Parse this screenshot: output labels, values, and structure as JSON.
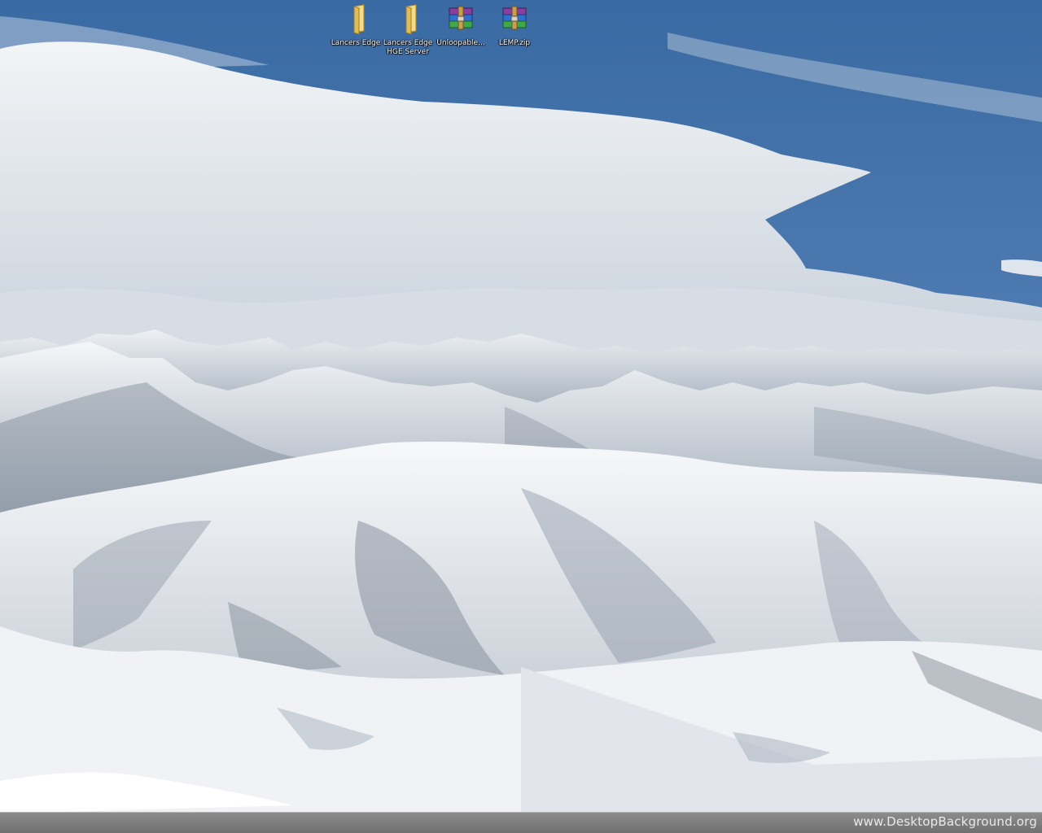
{
  "desktop": {
    "icons": [
      {
        "label": "Lancers Edge",
        "icon": "folder-icon"
      },
      {
        "label": "Lancers Edge HGE Server",
        "icon": "folder-icon"
      },
      {
        "label": "Unloopable...",
        "icon": "winrar-archive-icon"
      },
      {
        "label": "LEMP.zip",
        "icon": "winrar-archive-icon"
      }
    ]
  },
  "watermark": {
    "text": "www.DesktopBackground.org"
  },
  "colors": {
    "sky": "#3f6fa6",
    "snow": "#e8ecf1",
    "folder": "#e7c86a",
    "taskbar": "#7a7a7a"
  }
}
